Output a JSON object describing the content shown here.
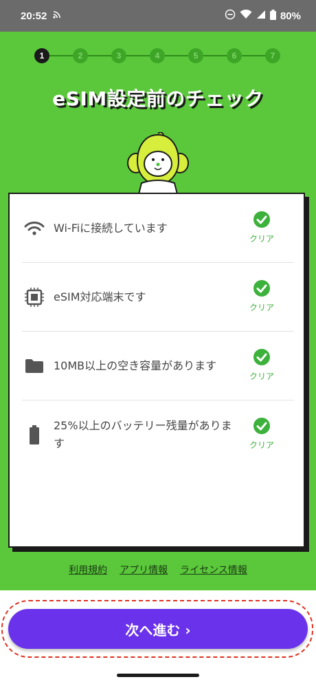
{
  "status_bar": {
    "time": "20:52",
    "battery": "80%"
  },
  "stepper": {
    "steps": [
      "1",
      "2",
      "3",
      "4",
      "5",
      "6",
      "7"
    ],
    "active": 1
  },
  "page": {
    "title": "eSIM設定前のチェック"
  },
  "checks": [
    {
      "text": "Wi-Fiに接続しています",
      "icon": "wifi-icon",
      "status": "クリア"
    },
    {
      "text": "eSIM対応端末です",
      "icon": "chip-icon",
      "status": "クリア"
    },
    {
      "text": "10MB以上の空き容量があります",
      "icon": "folder-icon",
      "status": "クリア"
    },
    {
      "text": "25%以上のバッテリー残量があります",
      "icon": "battery-icon",
      "status": "クリア"
    }
  ],
  "footer": {
    "terms": "利用規約",
    "app_info": "アプリ情報",
    "license": "ライセンス情報"
  },
  "actions": {
    "next_label": "次へ進む ›"
  },
  "colors": {
    "background": "#5bc83c",
    "accent": "#6a32ea",
    "check": "#3cb13b"
  }
}
